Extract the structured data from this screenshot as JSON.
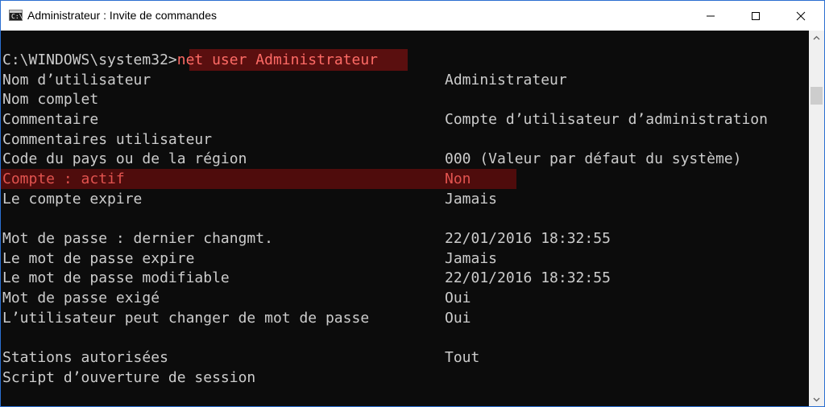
{
  "window": {
    "title": "Administrateur : Invite de commandes",
    "icon": "cmd-icon",
    "icon_text": "C:\\",
    "accent_color": "#2b6fd1"
  },
  "console": {
    "prompt": "C:\\WINDOWS\\system32>",
    "command": "net user Administrateur",
    "highlight_color": "#5a0f0f",
    "highlight_text_color": "#e2534f",
    "rows": [
      {
        "label": "Nom d’utilisateur",
        "value": "Administrateur"
      },
      {
        "label": "Nom complet",
        "value": ""
      },
      {
        "label": "Commentaire",
        "value": "Compte d’utilisateur d’administration"
      },
      {
        "label": "Commentaires utilisateur",
        "value": ""
      },
      {
        "label": "Code du pays ou de la région",
        "value": "000 (Valeur par défaut du système)"
      },
      {
        "label": "Compte : actif",
        "value": "Non"
      },
      {
        "label": "Le compte expire",
        "value": "Jamais"
      },
      {
        "label": "",
        "value": ""
      },
      {
        "label": "Mot de passe : dernier changmt.",
        "value": "22/01/2016 18:32:55"
      },
      {
        "label": "Le mot de passe expire",
        "value": "Jamais"
      },
      {
        "label": "Le mot de passe modifiable",
        "value": "22/01/2016 18:32:55"
      },
      {
        "label": "Mot de passe exigé",
        "value": "Oui"
      },
      {
        "label": "L’utilisateur peut changer de mot de passe",
        "value": "Oui"
      },
      {
        "label": "",
        "value": ""
      },
      {
        "label": "Stations autorisées",
        "value": "Tout"
      },
      {
        "label": "Script d’ouverture de session",
        "value": ""
      }
    ]
  },
  "controls": {
    "minimize_icon": "minimize-icon",
    "maximize_icon": "maximize-icon",
    "close_icon": "close-icon"
  }
}
